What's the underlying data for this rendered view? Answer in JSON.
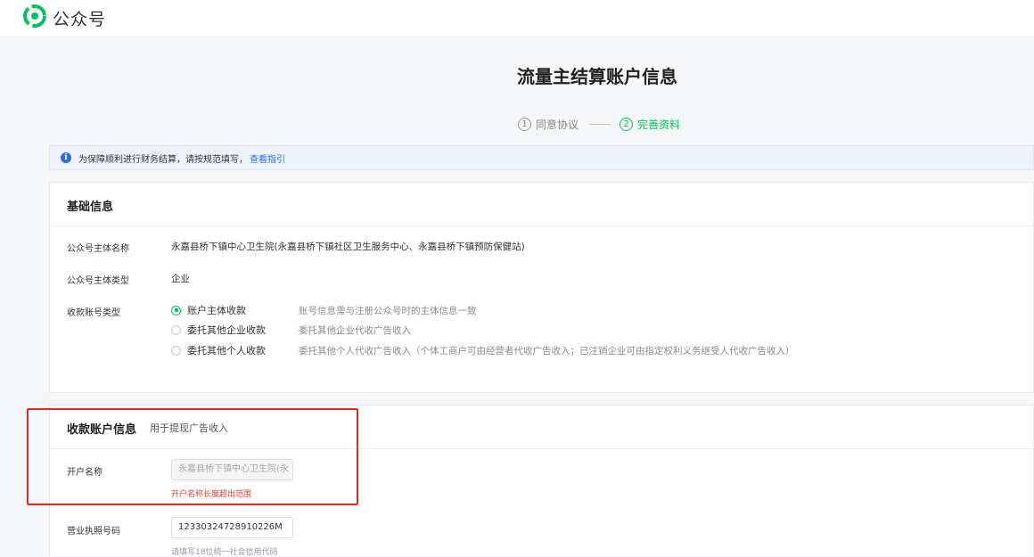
{
  "app": {
    "brand": "公众号",
    "logo_icon": "wechat-official-account-logo"
  },
  "page_title": "流量主结算账户信息",
  "steps": [
    {
      "num": "1",
      "label": "同意协议"
    },
    {
      "num": "2",
      "label": "完善资料"
    }
  ],
  "notice": {
    "text": "为保障顺利进行财务结算，请按规范填写，",
    "link": "查看指引"
  },
  "basic": {
    "title": "基础信息",
    "subject_name_label": "公众号主体名称",
    "subject_name_value": "永嘉县桥下镇中心卫生院(永嘉县桥下镇社区卫生服务中心、永嘉县桥下镇预防保健站)",
    "subject_type_label": "公众号主体类型",
    "subject_type_value": "企业",
    "account_type_label": "收款账号类型",
    "options": [
      {
        "label": "账户主体收款",
        "hint": "账号信息需与注册公众号时的主体信息一致",
        "checked": true
      },
      {
        "label": "委托其他企业收款",
        "hint": "委托其他企业代收广告收入",
        "checked": false
      },
      {
        "label": "委托其他个人收款",
        "hint": "委托其他个人代收广告收入（个体工商户可由经营者代收广告收入；已注销企业可由指定权利义务继受人代收广告收入）",
        "checked": false
      }
    ]
  },
  "payee": {
    "title": "收款账户信息",
    "subtitle": "用于提现广告收入",
    "account_name_label": "开户名称",
    "account_name_value": "永嘉县桥下镇中心卫生院(永",
    "account_name_error": "开户名称长度超出范围",
    "license_label": "营业执照号码",
    "license_value": "1233032472891022​6M",
    "license_hint": "请填写18位统一社会信用代码"
  },
  "colors": {
    "accent": "#07c160",
    "error": "#e03a3a",
    "link": "#2e6fd6",
    "highlight": "#e8262a"
  }
}
